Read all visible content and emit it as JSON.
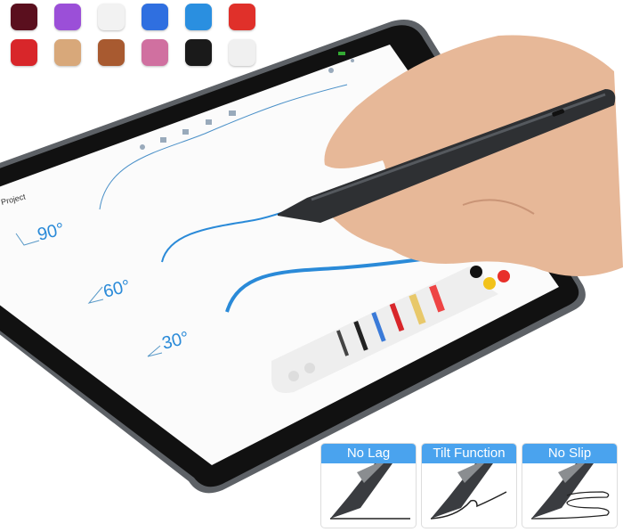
{
  "app_icons": [
    {
      "name": "eye-app-icon",
      "color": "#5a0f1e"
    },
    {
      "name": "affinity-photo-icon",
      "color": "#9b4fd8"
    },
    {
      "name": "drawing-app-icon",
      "color": "#f2f2f2"
    },
    {
      "name": "notability-icon",
      "color": "#2f6fe0"
    },
    {
      "name": "star-app-icon",
      "color": "#2a8fe0"
    },
    {
      "name": "pdf-expert-icon",
      "color": "#e0302a"
    },
    {
      "name": "pen-app-icon",
      "color": "#d8262a"
    },
    {
      "name": "art-set-icon",
      "color": "#d8a87a"
    },
    {
      "name": "signature-app-icon",
      "color": "#a85a30"
    },
    {
      "name": "vectornator-icon",
      "color": "#d070a0"
    },
    {
      "name": "procreate-icon",
      "color": "#1a1a1a"
    },
    {
      "name": "paper-53-icon",
      "color": "#f0f0f0"
    }
  ],
  "screen": {
    "project_label": "Project",
    "angles": [
      "90°",
      "60°",
      "30°"
    ],
    "accent": "#2a8ad8"
  },
  "features": [
    {
      "label": "No Lag"
    },
    {
      "label": "Tilt Function"
    },
    {
      "label": "No Slip"
    }
  ],
  "colors": {
    "header_blue": "#4aa3ee",
    "stylus": "#2e3033",
    "bezel": "#111111"
  }
}
